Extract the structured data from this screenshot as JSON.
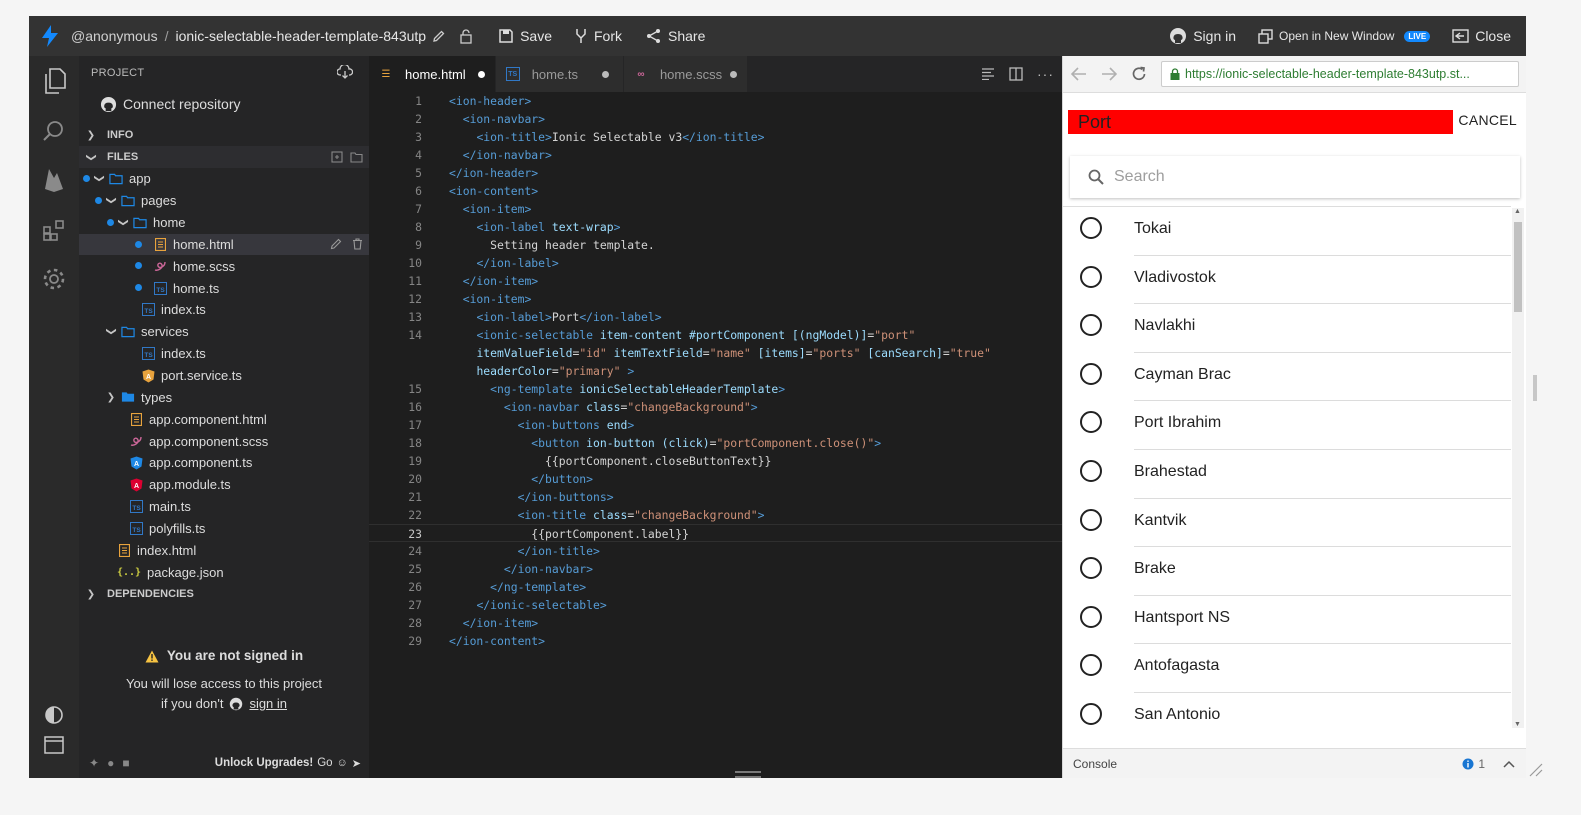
{
  "topbar": {
    "user": "@anonymous",
    "separator": "/",
    "project": "ionic-selectable-header-template-843utp",
    "save_label": "Save",
    "fork_label": "Fork",
    "share_label": "Share",
    "signin_label": "Sign in",
    "open_window_label": "Open in New Window",
    "live_badge": "LIVE",
    "close_label": "Close"
  },
  "sidebar": {
    "project_heading": "PROJECT",
    "connect_label": "Connect repository",
    "info_label": "INFO",
    "files_label": "FILES",
    "dependencies_label": "DEPENDENCIES",
    "tree": [
      {
        "name": "app",
        "type": "folder",
        "depth": 0,
        "open": true,
        "dot": true
      },
      {
        "name": "pages",
        "type": "folder",
        "depth": 1,
        "open": true,
        "dot": true
      },
      {
        "name": "home",
        "type": "folder",
        "depth": 2,
        "open": true,
        "dot": true
      },
      {
        "name": "home.html",
        "type": "html",
        "depth": 3,
        "dot": true,
        "selected": true
      },
      {
        "name": "home.scss",
        "type": "scss",
        "depth": 3,
        "dot": true
      },
      {
        "name": "home.ts",
        "type": "ts",
        "depth": 3,
        "dot": true
      },
      {
        "name": "index.ts",
        "type": "ts",
        "depth": 2
      },
      {
        "name": "services",
        "type": "folder",
        "depth": 1,
        "open": true
      },
      {
        "name": "index.ts",
        "type": "ts",
        "depth": 2
      },
      {
        "name": "port.service.ts",
        "type": "angular",
        "depth": 2
      },
      {
        "name": "types",
        "type": "folder",
        "depth": 1,
        "open": false,
        "filled": true
      },
      {
        "name": "app.component.html",
        "type": "html",
        "depth": 1
      },
      {
        "name": "app.component.scss",
        "type": "scss",
        "depth": 1
      },
      {
        "name": "app.component.ts",
        "type": "angular-blue",
        "depth": 1
      },
      {
        "name": "app.module.ts",
        "type": "angular",
        "depth": 1
      },
      {
        "name": "main.ts",
        "type": "ts",
        "depth": 1
      },
      {
        "name": "polyfills.ts",
        "type": "ts",
        "depth": 1
      },
      {
        "name": "index.html",
        "type": "html",
        "depth": 0
      },
      {
        "name": "package.json",
        "type": "json",
        "depth": 0
      }
    ],
    "notice_title": "You are not signed in",
    "notice_line1": "You will lose access to this project",
    "notice_line2": "if you don't",
    "notice_link": "sign in",
    "footer_upgrade": "Unlock Upgrades!",
    "footer_go": "Go"
  },
  "editor": {
    "tabs": [
      {
        "label": "home.html",
        "icon": "html",
        "active": true
      },
      {
        "label": "home.ts",
        "icon": "ts",
        "active": false
      },
      {
        "label": "home.scss",
        "icon": "scss",
        "active": false
      }
    ],
    "current_line": "23"
  },
  "preview": {
    "url": "https://ionic-selectable-header-template-843utp.st...",
    "header_title": "Port",
    "cancel_label": "CANCEL",
    "search_placeholder": "Search",
    "items": [
      "Tokai",
      "Vladivostok",
      "Navlakhi",
      "Cayman Brac",
      "Port Ibrahim",
      "Brahestad",
      "Kantvik",
      "Brake",
      "Hantsport NS",
      "Antofagasta",
      "San Antonio"
    ],
    "console_label": "Console",
    "console_count": "1"
  },
  "colors": {
    "header_red": "#ff0000",
    "accent_blue": "#1e88e5",
    "live_blue": "#1389fd"
  }
}
